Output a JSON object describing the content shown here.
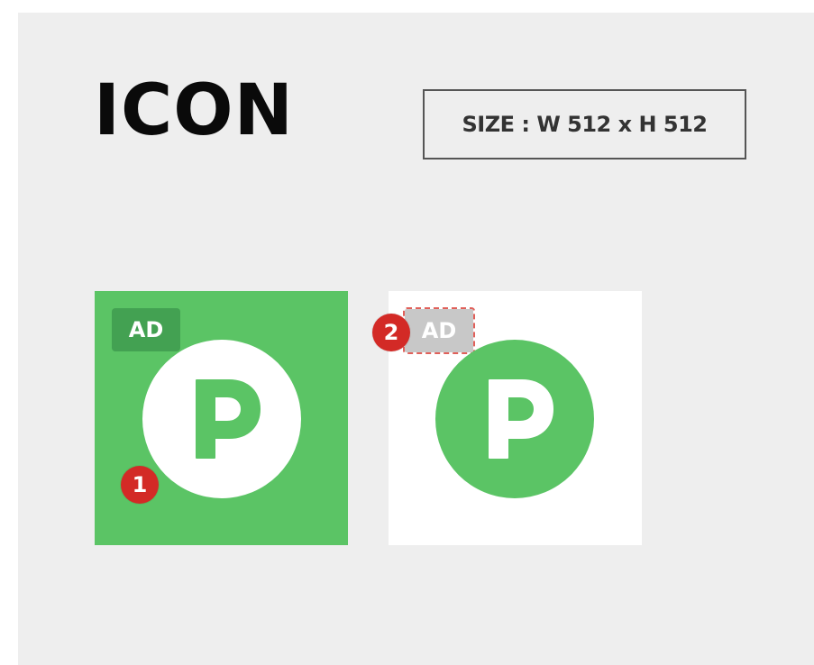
{
  "header": {
    "title": "ICON",
    "size_label": "SIZE : W 512 x H 512"
  },
  "icons": [
    {
      "variant": "green-background",
      "ad_label": "AD",
      "glyph": "P",
      "background_color": "#5bc465",
      "badge_color": "#43a152",
      "circle_color": "#ffffff",
      "glyph_color": "#5bc465",
      "marker_number": "1"
    },
    {
      "variant": "white-background",
      "ad_label": "AD",
      "glyph": "P",
      "background_color": "#ffffff",
      "badge_color": "#c8c8c8",
      "circle_color": "#5bc465",
      "glyph_color": "#ffffff",
      "marker_number": "2"
    }
  ],
  "colors": {
    "page_background": "#eeeeee",
    "marker": "#d32a26",
    "highlight_border": "#e0605a"
  }
}
